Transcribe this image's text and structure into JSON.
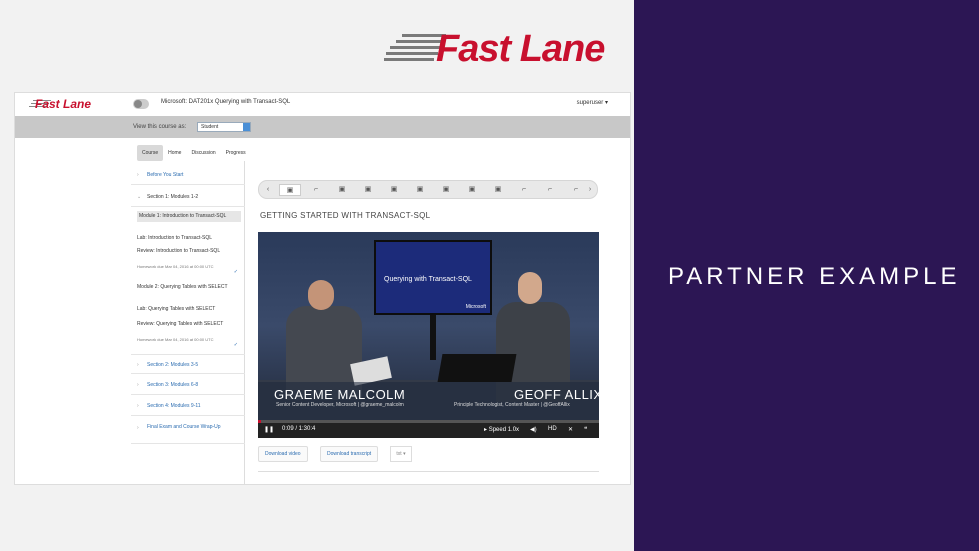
{
  "brand": {
    "name": "Fast Lane"
  },
  "partner_label": "PARTNER EXAMPLE",
  "app": {
    "logo": "Fast Lane",
    "course_title": "Microsoft: DAT201x Querying with Transact-SQL",
    "user": "superuser",
    "view_label": "View this course as:",
    "role": "Student"
  },
  "tabs": [
    "Course",
    "Home",
    "Discussion",
    "Progress"
  ],
  "sidebar": {
    "before_start": "Before You Start",
    "section1": "Section 1: Modules 1-2",
    "module1": "Module 1: Introduction to Transact-SQL",
    "lab1": "Lab: Introduction to Transact-SQL",
    "review1": "Review: Introduction to Transact-SQL",
    "due1": "Homework due Mar 04, 2016 at 00:00 UTC",
    "module2": "Module 2: Querying Tables with SELECT",
    "lab2": "Lab: Querying Tables with SELECT",
    "review2": "Review: Querying Tables with SELECT",
    "due2": "Homework due Mar 04, 2016 at 00:00 UTC",
    "section2": "Section 2: Modules 3-5",
    "section3": "Section 3: Modules 6-8",
    "section4": "Section 4: Modules 9-11",
    "final": "Final Exam and Course Wrap-Up"
  },
  "unit_title": "GETTING STARTED WITH TRANSACT-SQL",
  "video": {
    "screen_text": "Querying with Transact-SQL",
    "screen_brand": "Microsoft",
    "speaker_left": "GRAEME MALCOLM",
    "speaker_left_role": "Senior Content Developer, Microsoft | @graeme_malcolm",
    "speaker_right": "GEOFF ALLIX",
    "speaker_right_role": "Principle Technologist, Content Master | @GeoffAllix",
    "time": "0:09 / 1:30:4",
    "speed": "Speed 1.0x",
    "progress": 0.01
  },
  "downloads": {
    "video": "Download video",
    "transcript": "Download transcript",
    "format": "txt"
  }
}
